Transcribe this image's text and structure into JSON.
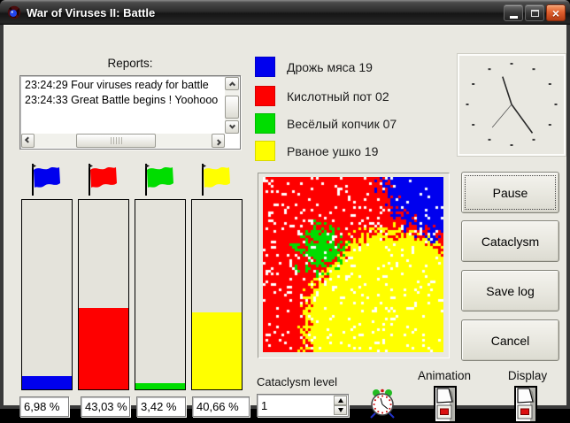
{
  "window": {
    "title": "War of Viruses II: Battle"
  },
  "reports": {
    "label": "Reports:",
    "lines": [
      "23:24:29 Four viruses ready for battle",
      "23:24:33 Great Battle begins ! Yoohooo"
    ]
  },
  "viruses": [
    {
      "name": "Дрожь мяса 19",
      "color": "#0000ee",
      "percent": 6.98,
      "percent_label": "6,98 %"
    },
    {
      "name": "Кислотный пот 02",
      "color": "#fe0000",
      "percent": 43.03,
      "percent_label": "43,03 %"
    },
    {
      "name": "Весёлый копчик 07",
      "color": "#00dd00",
      "percent": 3.42,
      "percent_label": "3,42 %"
    },
    {
      "name": "Рваное ушко 19",
      "color": "#ffff00",
      "percent": 40.66,
      "percent_label": "40,66 %"
    }
  ],
  "buttons": {
    "pause": "Pause",
    "cataclysm": "Cataclysm",
    "save_log": "Save log",
    "cancel": "Cancel"
  },
  "cataclysm": {
    "label": "Cataclysm level",
    "value": "1"
  },
  "switches": {
    "animation": "Animation",
    "display": "Display"
  },
  "clock": {
    "hour_angle": 342,
    "minute_angle": 144,
    "second_angle": 220
  },
  "battle": {
    "background_color": "#fe0000",
    "blue_color": "#0000ee",
    "yellow_color": "#ffff00",
    "green_color": "#00dd00",
    "speckle_color": "#ffffff",
    "speckle_density": 0.08
  }
}
